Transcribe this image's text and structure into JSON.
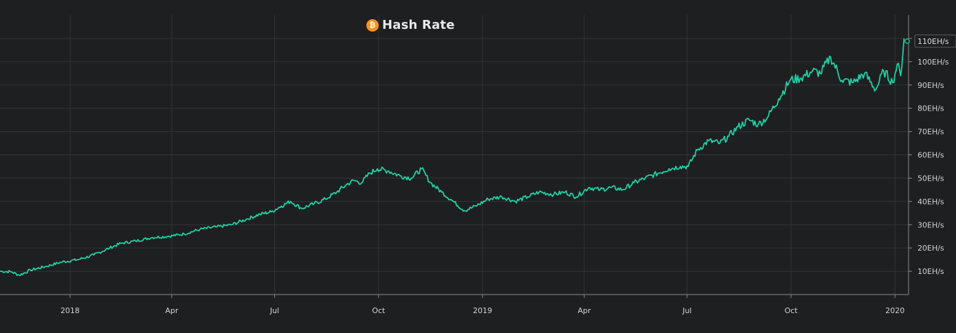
{
  "chart_data": {
    "type": "line",
    "title": "Hash Rate",
    "title_icon": "bitcoin-icon",
    "xlabel": "",
    "ylabel": "",
    "x_tick_labels": [
      "2018",
      "Apr",
      "Jul",
      "Oct",
      "2019",
      "Apr",
      "Jul",
      "Oct",
      "2020"
    ],
    "y_tick_labels": [
      "10EH/s",
      "20EH/s",
      "30EH/s",
      "40EH/s",
      "50EH/s",
      "60EH/s",
      "70EH/s",
      "80EH/s",
      "90EH/s",
      "100EH/s",
      "110EH/s"
    ],
    "y_ticks": [
      10,
      20,
      30,
      40,
      50,
      60,
      70,
      80,
      90,
      100,
      110
    ],
    "x_tick_dates": [
      "2018-01-01",
      "2018-04-01",
      "2018-07-01",
      "2018-10-01",
      "2019-01-01",
      "2019-04-01",
      "2019-07-01",
      "2019-10-01",
      "2020-01-01"
    ],
    "xlim": [
      "2017-10-31",
      "2020-01-13"
    ],
    "ylim": [
      0,
      120
    ],
    "grid": true,
    "last_value_label": "110EH/s",
    "series": [
      {
        "color": "#1fd1a5",
        "x": [
          "2017-10-31",
          "2017-11-10",
          "2017-11-17",
          "2017-11-27",
          "2017-12-10",
          "2017-12-25",
          "2018-01-08",
          "2018-01-22",
          "2018-02-05",
          "2018-02-15",
          "2018-02-28",
          "2018-03-15",
          "2018-03-29",
          "2018-04-12",
          "2018-04-26",
          "2018-05-10",
          "2018-05-24",
          "2018-06-07",
          "2018-06-18",
          "2018-06-28",
          "2018-07-07",
          "2018-07-15",
          "2018-07-25",
          "2018-08-05",
          "2018-08-15",
          "2018-08-25",
          "2018-09-02",
          "2018-09-09",
          "2018-09-16",
          "2018-09-23",
          "2018-09-30",
          "2018-10-10",
          "2018-10-20",
          "2018-10-30",
          "2018-11-08",
          "2018-11-16",
          "2018-11-26",
          "2018-12-06",
          "2018-12-16",
          "2018-12-26",
          "2019-01-06",
          "2019-01-18",
          "2019-01-30",
          "2019-02-10",
          "2019-02-20",
          "2019-03-05",
          "2019-03-15",
          "2019-03-25",
          "2019-04-05",
          "2019-04-15",
          "2019-04-25",
          "2019-05-05",
          "2019-05-15",
          "2019-05-25",
          "2019-06-05",
          "2019-06-15",
          "2019-06-25",
          "2019-07-02",
          "2019-07-10",
          "2019-07-20",
          "2019-07-30",
          "2019-08-07",
          "2019-08-15",
          "2019-08-25",
          "2019-09-02",
          "2019-09-10",
          "2019-09-20",
          "2019-09-30",
          "2019-10-10",
          "2019-10-20",
          "2019-10-27",
          "2019-11-05",
          "2019-11-15",
          "2019-11-25",
          "2019-12-05",
          "2019-12-15",
          "2019-12-22",
          "2019-12-30",
          "2020-01-03",
          "2020-01-06",
          "2020-01-09"
        ],
        "values": [
          10,
          9.8,
          8.3,
          10.5,
          12,
          14,
          15,
          17,
          20,
          22,
          23,
          24.5,
          25,
          26,
          28,
          29,
          30,
          32.5,
          34.5,
          35.5,
          38,
          40,
          37,
          39,
          41,
          44,
          47,
          49,
          48,
          52,
          54,
          53,
          51,
          50,
          54,
          48,
          44,
          40,
          36,
          38,
          41,
          42,
          40,
          42,
          44,
          43,
          44,
          42,
          46,
          45,
          46,
          45,
          48,
          50,
          52,
          54,
          55,
          55,
          62,
          66,
          65,
          68,
          72,
          75,
          73,
          76,
          84,
          92,
          93,
          96,
          95,
          102,
          92,
          91,
          95,
          88,
          96,
          91,
          99,
          94,
          110
        ]
      }
    ]
  }
}
